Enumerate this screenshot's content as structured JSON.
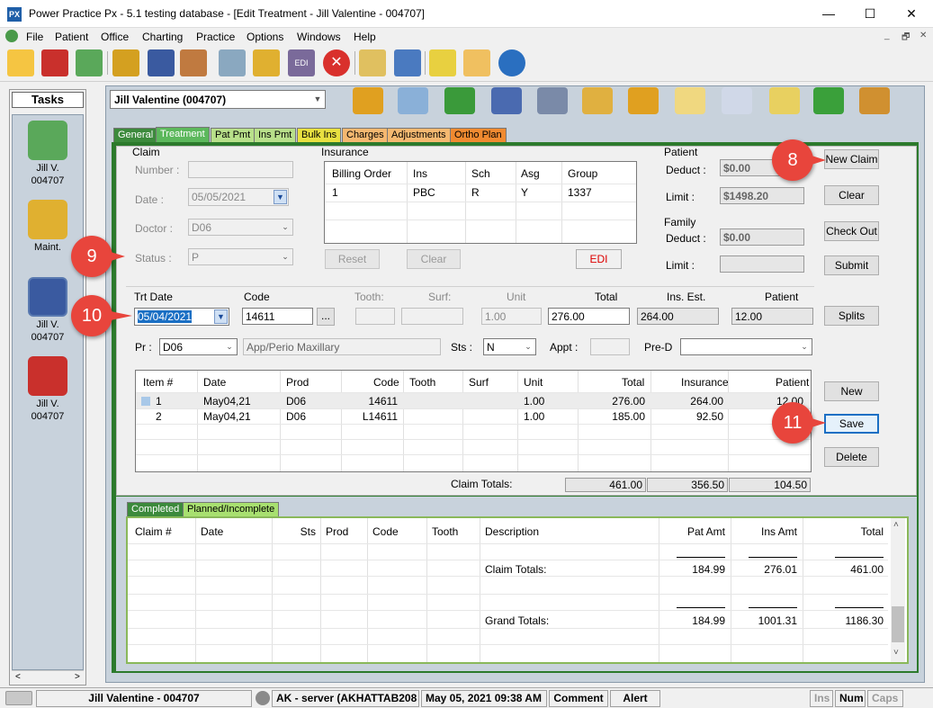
{
  "window": {
    "app_icon": "PX",
    "title": "Power Practice Px - 5.1 testing database - [Edit Treatment - Jill Valentine - 004707]",
    "minimize": "—",
    "maximize": "☐",
    "close": "✕"
  },
  "menu": [
    "File",
    "Patient",
    "Office",
    "Charting",
    "Practice",
    "Options",
    "Windows",
    "Help"
  ],
  "mdi_controls": [
    "_",
    "🗗",
    "✕"
  ],
  "toolbar_icons": [
    "open-folder-icon",
    "patients-icon",
    "recycle-icon",
    "edit-pencil-icon",
    "book-icon",
    "calendar-icon",
    "chart-icon",
    "gift-box-icon",
    "edi-icon",
    "stop-icon",
    "id-card-icon",
    "bottle-icon",
    "clipboard-icon",
    "notepad-icon",
    "help-icon"
  ],
  "tasks": {
    "header": "Tasks",
    "items": [
      {
        "label1": "Jill V.",
        "label2": "004707",
        "icon": "recycle-icon"
      },
      {
        "label1": "Maint.",
        "label2": "",
        "icon": "gift-box-icon"
      },
      {
        "label1": "Jill V.",
        "label2": "004707",
        "icon": "book-icon"
      },
      {
        "label1": "Jill V.",
        "label2": "004707",
        "icon": "patients-icon"
      }
    ],
    "scroll_left": "<",
    "scroll_right": ">"
  },
  "patient_selector": "Jill Valentine (004707)",
  "tabs": [
    {
      "label": "General",
      "color": "#3c8a3c",
      "text": "#ffffff"
    },
    {
      "label": "Treatment",
      "color": "#5cb85c",
      "text": "#ffffff"
    },
    {
      "label": "Pat Pmt",
      "color": "#b8e08a",
      "text": "#000000"
    },
    {
      "label": "Ins Pmt",
      "color": "#b8e08a",
      "text": "#000000"
    },
    {
      "label": "Bulk Ins",
      "color": "#e8e040",
      "text": "#000000"
    },
    {
      "label": "Charges",
      "color": "#f5b870",
      "text": "#000000"
    },
    {
      "label": "Adjustments",
      "color": "#f5b870",
      "text": "#000000"
    },
    {
      "label": "Ortho Plan",
      "color": "#f08a30",
      "text": "#000000"
    }
  ],
  "claim": {
    "section": "Claim",
    "number_label": "Number :",
    "number_value": "",
    "date_label": "Date :",
    "date_value": "05/05/2021",
    "doctor_label": "Doctor :",
    "doctor_value": "D06",
    "status_label": "Status :",
    "status_value": "P"
  },
  "insurance": {
    "section": "Insurance",
    "columns": [
      "Billing Order",
      "Ins",
      "Sch",
      "Asg",
      "Group"
    ],
    "rows": [
      [
        "1",
        "PBC",
        "R",
        "Y",
        "1337"
      ]
    ],
    "reset": "Reset",
    "clear": "Clear",
    "edi": "EDI"
  },
  "patient": {
    "section": "Patient",
    "deduct_label": "Deduct :",
    "deduct_value": "$0.00",
    "limit_label": "Limit :",
    "limit_value": "$1498.20"
  },
  "family": {
    "section": "Family",
    "deduct_label": "Deduct :",
    "deduct_value": "$0.00",
    "limit_label": "Limit :",
    "limit_value": ""
  },
  "right_buttons": {
    "new_claim": "New Claim",
    "clear": "Clear",
    "check_out": "Check Out",
    "submit": "Submit",
    "splits": "Splits",
    "new": "New",
    "save": "Save",
    "delete": "Delete"
  },
  "entry": {
    "trt_date_label": "Trt Date",
    "trt_date_value": "05/04/2021",
    "code_label": "Code",
    "code_value": "14611",
    "lookup": "...",
    "tooth_label": "Tooth:",
    "surf_label": "Surf:",
    "unit_label": "Unit",
    "unit_value": "1.00",
    "total_label": "Total",
    "total_value": "276.00",
    "ins_est_label": "Ins. Est.",
    "ins_est_value": "264.00",
    "patient_label": "Patient",
    "patient_value": "12.00",
    "pr_label": "Pr :",
    "pr_value": "D06",
    "description": "App/Perio Maxillary",
    "sts_label": "Sts :",
    "sts_value": "N",
    "appt_label": "Appt :",
    "appt_value": "",
    "pred_label": "Pre-D",
    "pred_value": ""
  },
  "items_grid": {
    "columns": [
      "Item #",
      "Date",
      "Prod",
      "Code",
      "Tooth",
      "Surf",
      "Unit",
      "Total",
      "Insurance",
      "Patient"
    ],
    "rows": [
      [
        "1",
        "May04,21",
        "D06",
        "14611",
        "",
        "",
        "1.00",
        "276.00",
        "264.00",
        "12.00"
      ],
      [
        "2",
        "May04,21",
        "D06",
        "L14611",
        "",
        "",
        "1.00",
        "185.00",
        "92.50",
        "92.50"
      ]
    ],
    "claim_totals_label": "Claim Totals:",
    "claim_totals": [
      "461.00",
      "356.50",
      "104.50"
    ]
  },
  "bottom_tabs": [
    {
      "label": "Completed"
    },
    {
      "label": "Planned/Incomplete"
    }
  ],
  "bottom_grid": {
    "columns": [
      "Claim #",
      "Date",
      "Sts",
      "Prod",
      "Code",
      "Tooth",
      "Description",
      "Pat Amt",
      "Ins Amt",
      "Total"
    ],
    "claim_totals_label": "Claim Totals:",
    "claim_totals": [
      "184.99",
      "276.01",
      "461.00"
    ],
    "grand_totals_label": "Grand Totals:",
    "grand_totals": [
      "184.99",
      "1001.31",
      "1186.30"
    ]
  },
  "callouts": [
    "8",
    "9",
    "10",
    "11"
  ],
  "status_bar": {
    "patient": "Jill Valentine - 004707",
    "server": "AK - server (AKHATTAB208",
    "datetime": "May 05, 2021 09:38 AM",
    "comment": "Comment",
    "alert": "Alert",
    "ins": "Ins",
    "num": "Num",
    "caps": "Caps"
  }
}
